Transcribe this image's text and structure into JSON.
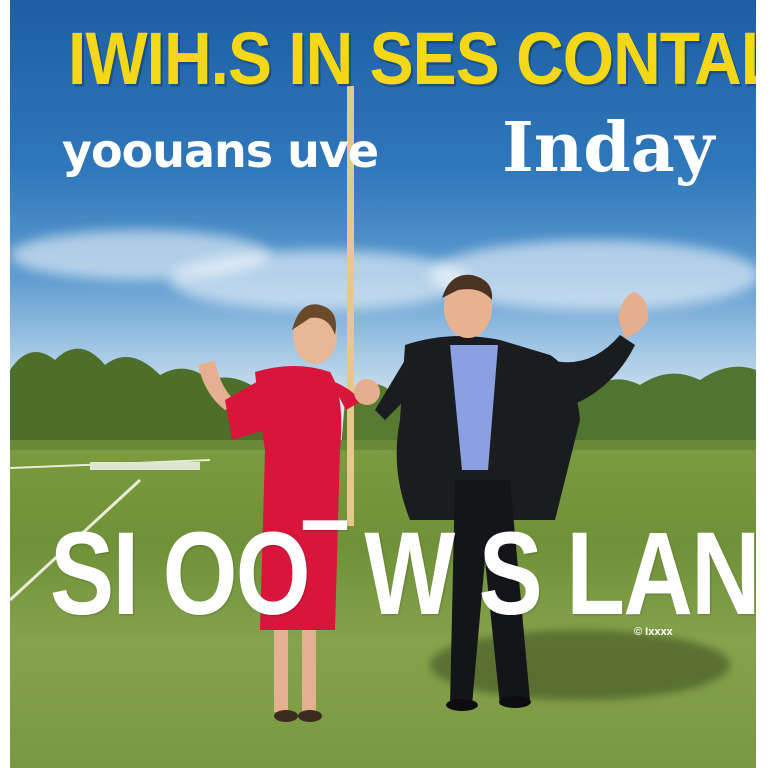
{
  "poster": {
    "headline": "IWIH.S IN SES CONTALHE",
    "subtitle_left": "yoouans uve",
    "subtitle_right": "Inday",
    "overlay_text": "SI OO‾ W S LANIIE",
    "credit": "© Ixxxx"
  },
  "colors": {
    "headline": "#f4d817",
    "sky": "#2f78bb",
    "grass": "#7c9a3f",
    "dress": "#d8163c",
    "suit": "#1b1c20",
    "shirt": "#8aa0e0"
  }
}
